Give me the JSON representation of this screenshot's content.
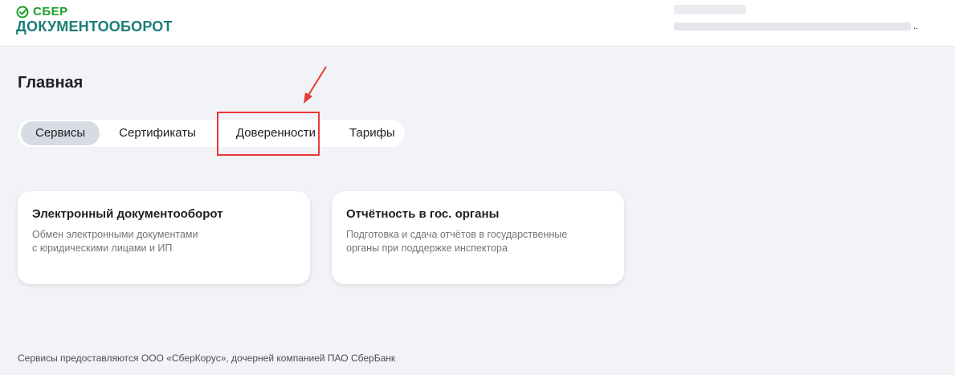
{
  "header": {
    "logo_brand": "СБЕР",
    "logo_product": "ДОКУМЕНТООБОРОТ",
    "user_trailing": ".."
  },
  "main": {
    "title": "Главная",
    "tabs": [
      {
        "label": "Сервисы",
        "active": true
      },
      {
        "label": "Сертификаты",
        "active": false
      },
      {
        "label": "Доверенности",
        "active": false
      },
      {
        "label": "Тарифы",
        "active": false
      }
    ],
    "cards": [
      {
        "title": "Электронный документооборот",
        "description": "Обмен электронными документами\nс юридическими лицами и ИП"
      },
      {
        "title": "Отчётность в гос. органы",
        "description": "Подготовка и сдача отчётов в государственные\nорганы при поддержке инспектора"
      }
    ]
  },
  "footer": {
    "text": "Сервисы предоставляются ООО «СберКорус», дочерней компанией ПАО СберБанк"
  },
  "colors": {
    "brand_green": "#1a9f29",
    "product_teal": "#1a7e7a",
    "annotation_red": "#e53935"
  }
}
